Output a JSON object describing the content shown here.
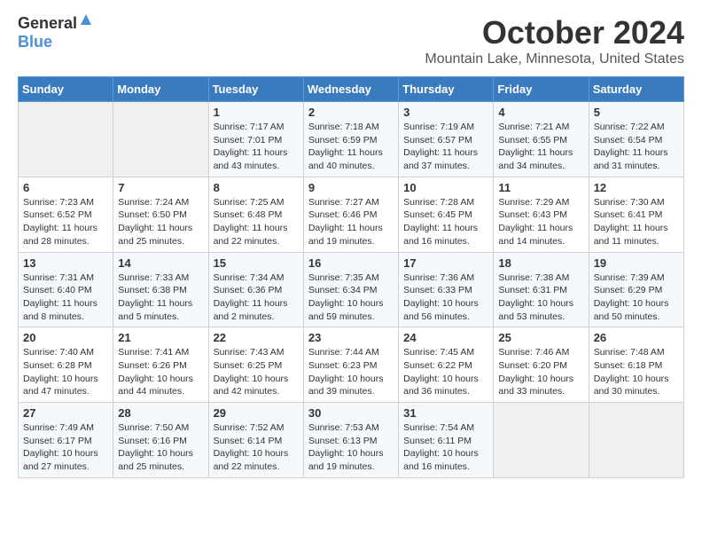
{
  "logo": {
    "general": "General",
    "blue": "Blue"
  },
  "header": {
    "month": "October 2024",
    "location": "Mountain Lake, Minnesota, United States"
  },
  "days_of_week": [
    "Sunday",
    "Monday",
    "Tuesday",
    "Wednesday",
    "Thursday",
    "Friday",
    "Saturday"
  ],
  "weeks": [
    [
      {
        "day": "",
        "empty": true
      },
      {
        "day": "",
        "empty": true
      },
      {
        "day": "1",
        "sunrise": "7:17 AM",
        "sunset": "7:01 PM",
        "daylight": "11 hours and 43 minutes."
      },
      {
        "day": "2",
        "sunrise": "7:18 AM",
        "sunset": "6:59 PM",
        "daylight": "11 hours and 40 minutes."
      },
      {
        "day": "3",
        "sunrise": "7:19 AM",
        "sunset": "6:57 PM",
        "daylight": "11 hours and 37 minutes."
      },
      {
        "day": "4",
        "sunrise": "7:21 AM",
        "sunset": "6:55 PM",
        "daylight": "11 hours and 34 minutes."
      },
      {
        "day": "5",
        "sunrise": "7:22 AM",
        "sunset": "6:54 PM",
        "daylight": "11 hours and 31 minutes."
      }
    ],
    [
      {
        "day": "6",
        "sunrise": "7:23 AM",
        "sunset": "6:52 PM",
        "daylight": "11 hours and 28 minutes."
      },
      {
        "day": "7",
        "sunrise": "7:24 AM",
        "sunset": "6:50 PM",
        "daylight": "11 hours and 25 minutes."
      },
      {
        "day": "8",
        "sunrise": "7:25 AM",
        "sunset": "6:48 PM",
        "daylight": "11 hours and 22 minutes."
      },
      {
        "day": "9",
        "sunrise": "7:27 AM",
        "sunset": "6:46 PM",
        "daylight": "11 hours and 19 minutes."
      },
      {
        "day": "10",
        "sunrise": "7:28 AM",
        "sunset": "6:45 PM",
        "daylight": "11 hours and 16 minutes."
      },
      {
        "day": "11",
        "sunrise": "7:29 AM",
        "sunset": "6:43 PM",
        "daylight": "11 hours and 14 minutes."
      },
      {
        "day": "12",
        "sunrise": "7:30 AM",
        "sunset": "6:41 PM",
        "daylight": "11 hours and 11 minutes."
      }
    ],
    [
      {
        "day": "13",
        "sunrise": "7:31 AM",
        "sunset": "6:40 PM",
        "daylight": "11 hours and 8 minutes."
      },
      {
        "day": "14",
        "sunrise": "7:33 AM",
        "sunset": "6:38 PM",
        "daylight": "11 hours and 5 minutes."
      },
      {
        "day": "15",
        "sunrise": "7:34 AM",
        "sunset": "6:36 PM",
        "daylight": "11 hours and 2 minutes."
      },
      {
        "day": "16",
        "sunrise": "7:35 AM",
        "sunset": "6:34 PM",
        "daylight": "10 hours and 59 minutes."
      },
      {
        "day": "17",
        "sunrise": "7:36 AM",
        "sunset": "6:33 PM",
        "daylight": "10 hours and 56 minutes."
      },
      {
        "day": "18",
        "sunrise": "7:38 AM",
        "sunset": "6:31 PM",
        "daylight": "10 hours and 53 minutes."
      },
      {
        "day": "19",
        "sunrise": "7:39 AM",
        "sunset": "6:29 PM",
        "daylight": "10 hours and 50 minutes."
      }
    ],
    [
      {
        "day": "20",
        "sunrise": "7:40 AM",
        "sunset": "6:28 PM",
        "daylight": "10 hours and 47 minutes."
      },
      {
        "day": "21",
        "sunrise": "7:41 AM",
        "sunset": "6:26 PM",
        "daylight": "10 hours and 44 minutes."
      },
      {
        "day": "22",
        "sunrise": "7:43 AM",
        "sunset": "6:25 PM",
        "daylight": "10 hours and 42 minutes."
      },
      {
        "day": "23",
        "sunrise": "7:44 AM",
        "sunset": "6:23 PM",
        "daylight": "10 hours and 39 minutes."
      },
      {
        "day": "24",
        "sunrise": "7:45 AM",
        "sunset": "6:22 PM",
        "daylight": "10 hours and 36 minutes."
      },
      {
        "day": "25",
        "sunrise": "7:46 AM",
        "sunset": "6:20 PM",
        "daylight": "10 hours and 33 minutes."
      },
      {
        "day": "26",
        "sunrise": "7:48 AM",
        "sunset": "6:18 PM",
        "daylight": "10 hours and 30 minutes."
      }
    ],
    [
      {
        "day": "27",
        "sunrise": "7:49 AM",
        "sunset": "6:17 PM",
        "daylight": "10 hours and 27 minutes."
      },
      {
        "day": "28",
        "sunrise": "7:50 AM",
        "sunset": "6:16 PM",
        "daylight": "10 hours and 25 minutes."
      },
      {
        "day": "29",
        "sunrise": "7:52 AM",
        "sunset": "6:14 PM",
        "daylight": "10 hours and 22 minutes."
      },
      {
        "day": "30",
        "sunrise": "7:53 AM",
        "sunset": "6:13 PM",
        "daylight": "10 hours and 19 minutes."
      },
      {
        "day": "31",
        "sunrise": "7:54 AM",
        "sunset": "6:11 PM",
        "daylight": "10 hours and 16 minutes."
      },
      {
        "day": "",
        "empty": true
      },
      {
        "day": "",
        "empty": true
      }
    ]
  ]
}
